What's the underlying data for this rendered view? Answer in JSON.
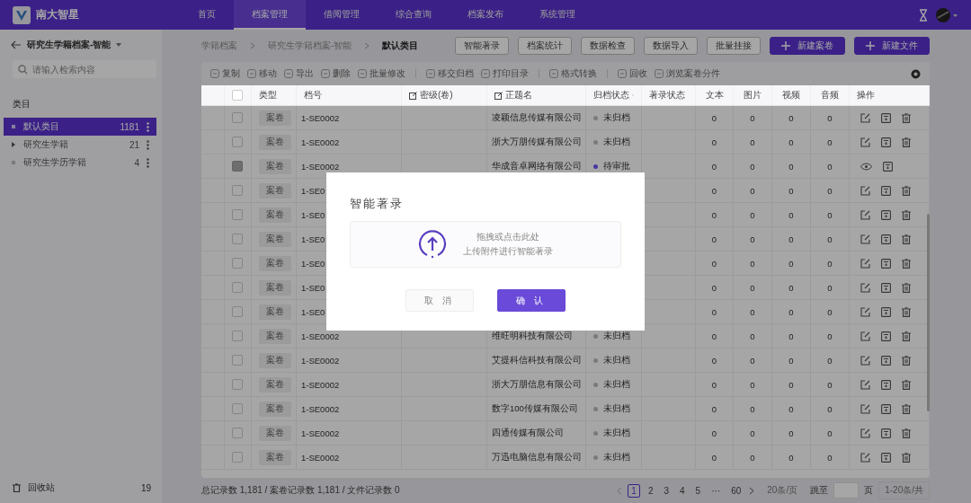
{
  "app": {
    "logo": "南大智星"
  },
  "nav": [
    {
      "label": "首页",
      "selected": false
    },
    {
      "label": "档案管理",
      "selected": true
    },
    {
      "label": "借阅管理",
      "selected": false
    },
    {
      "label": "综合查询",
      "selected": false
    },
    {
      "label": "档案发布",
      "selected": false
    },
    {
      "label": "系统管理",
      "selected": false
    }
  ],
  "sidebar": {
    "title": "研究生学籍档案-智能",
    "search": {
      "placeholder": "请输入检索内容"
    },
    "section": "类目",
    "items": [
      {
        "label": "默认类目",
        "count": "1181",
        "selected": true,
        "expandable": false
      },
      {
        "label": "研究生学籍",
        "count": "21",
        "selected": false,
        "expandable": true
      },
      {
        "label": "研究生学历学籍",
        "count": "4",
        "selected": false,
        "expandable": false
      }
    ],
    "recycle": {
      "label": "回收站",
      "count": "19"
    }
  },
  "breadcrumb": [
    "学籍档案",
    "研究生学籍档案-智能",
    "默认类目"
  ],
  "actions": [
    {
      "label": "智能著录",
      "kind": "outline"
    },
    {
      "label": "档案统计",
      "kind": "outline"
    },
    {
      "label": "数据检查",
      "kind": "outline"
    },
    {
      "label": "数据导入",
      "kind": "outline"
    },
    {
      "label": "批量挂接",
      "kind": "outline"
    },
    {
      "label": "新建案卷",
      "kind": "primary"
    },
    {
      "label": "新建文件",
      "kind": "primary"
    }
  ],
  "toolbar": [
    [
      "复制",
      "移动",
      "导出",
      "删除",
      "批量修改"
    ],
    [
      "移交归档",
      "打印目录"
    ],
    [
      "格式转换"
    ],
    [
      "回收",
      "浏览案卷分件"
    ]
  ],
  "table": {
    "select_all": {
      "checked": false
    },
    "columns": [
      "类型",
      "档号",
      "密级(卷)",
      "正题名",
      "归档状态",
      "著录状态",
      "文本",
      "图片",
      "视频",
      "音频",
      "操作"
    ],
    "rows": [
      {
        "type": "案卷",
        "code": "1-SE0002",
        "title": "凌颖信息传媒有限公司",
        "status": "未归档",
        "color": "#7a7a7a",
        "locked": false,
        "counts": [
          "0",
          "0",
          "0",
          "0"
        ]
      },
      {
        "type": "案卷",
        "code": "1-SE0002",
        "title": "浙大万朋传媒有限公司",
        "status": "未归档",
        "color": "#7a7a7a",
        "locked": false,
        "counts": [
          "0",
          "0",
          "0",
          "0"
        ]
      },
      {
        "type": "案卷",
        "code": "1-SE0002",
        "title": "华成音卓网络有限公司",
        "status": "待审批",
        "color": "#4a36a0",
        "locked": true,
        "counts": [
          "0",
          "0",
          "0",
          "0"
        ]
      },
      {
        "type": "案卷",
        "code": "1-SE0",
        "locked": false,
        "counts": [
          "0",
          "0",
          "0",
          "0"
        ]
      },
      {
        "type": "案卷",
        "code": "1-SE0",
        "locked": false,
        "counts": [
          "0",
          "0",
          "0",
          "0"
        ]
      },
      {
        "type": "案卷",
        "code": "1-SE0",
        "locked": false,
        "counts": [
          "0",
          "0",
          "0",
          "0"
        ]
      },
      {
        "type": "案卷",
        "code": "1-SE0",
        "locked": false,
        "counts": [
          "0",
          "0",
          "0",
          "0"
        ]
      },
      {
        "type": "案卷",
        "code": "1-SE0",
        "locked": false,
        "counts": [
          "0",
          "0",
          "0",
          "0"
        ]
      },
      {
        "type": "案卷",
        "code": "1-SE0",
        "locked": false,
        "counts": [
          "0",
          "0",
          "0",
          "0"
        ]
      },
      {
        "type": "案卷",
        "code": "1-SE0002",
        "title": "维旺明科技有限公司",
        "status": "未归档",
        "color": "#7a7a7a",
        "locked": false,
        "counts": [
          "0",
          "0",
          "0",
          "0"
        ]
      },
      {
        "type": "案卷",
        "code": "1-SE0002",
        "title": "艾提科信科技有限公司",
        "status": "未归档",
        "color": "#7a7a7a",
        "locked": false,
        "counts": [
          "0",
          "0",
          "0",
          "0"
        ]
      },
      {
        "type": "案卷",
        "code": "1-SE0002",
        "title": "浙大万朋信息有限公司",
        "status": "未归档",
        "color": "#7a7a7a",
        "locked": false,
        "counts": [
          "0",
          "0",
          "0",
          "0"
        ]
      },
      {
        "type": "案卷",
        "code": "1-SE0002",
        "title": "数字100传媒有限公司",
        "status": "未归档",
        "color": "#7a7a7a",
        "locked": false,
        "counts": [
          "0",
          "0",
          "0",
          "0"
        ]
      },
      {
        "type": "案卷",
        "code": "1-SE0002",
        "title": "四通传媒有限公司",
        "status": "未归档",
        "color": "#7a7a7a",
        "locked": false,
        "counts": [
          "0",
          "0",
          "0",
          "0"
        ]
      },
      {
        "type": "案卷",
        "code": "1-SE0002",
        "title": "万迅电脑信息有限公司",
        "status": "未归档",
        "color": "#7a7a7a",
        "locked": false,
        "counts": [
          "0",
          "0",
          "0",
          "0"
        ]
      }
    ]
  },
  "footer": {
    "totals": "总记录数 1,181  /  案卷记录数 1,181  /  文件记录数 0",
    "pages": [
      {
        "label": "1",
        "selected": true
      },
      {
        "label": "2",
        "selected": false
      },
      {
        "label": "3",
        "selected": false
      },
      {
        "label": "4",
        "selected": false
      },
      {
        "label": "5",
        "selected": false
      },
      {
        "label": "···",
        "selected": false
      },
      {
        "label": "60",
        "selected": false
      }
    ],
    "page_size": "20条/页",
    "jump_label": "跳至",
    "jump_unit": "页",
    "range": "1-20条/共"
  },
  "modal": {
    "title": "智能著录",
    "upload_line1": "拖拽或点击此处",
    "upload_line2": "上传附件进行智能著录",
    "cancel": "取 消",
    "confirm": "确 认"
  }
}
